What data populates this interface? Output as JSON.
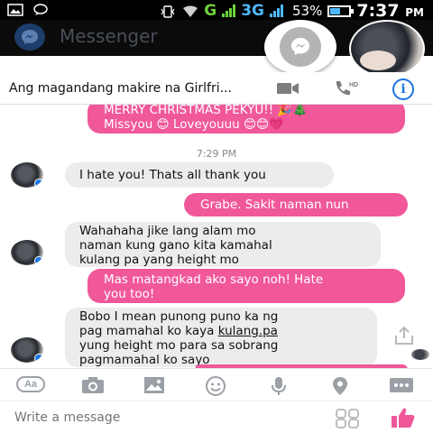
{
  "status_bar": {
    "network_g": "G",
    "network_3g": "3G",
    "battery": "53%",
    "battery_level": 0.53,
    "time": "7:37",
    "ampm": "PM"
  },
  "app_bar": {
    "title": "Messenger"
  },
  "conversation": {
    "name": "Ang magandang makire na Girlfri...",
    "icons": [
      "video-camera-icon",
      "phone-hd-icon",
      "info-icon"
    ],
    "accent_color": "#1b74e4",
    "sent_color": "#f0589a"
  },
  "messages": [
    {
      "from": "me",
      "lines": [
        "MERRY CHRISTMAS PEKYU!! 🎉🎄",
        "Missyou 😊 Loveyouuu 😊😊💗"
      ]
    },
    {
      "type": "timestamp",
      "text": "7:29 PM"
    },
    {
      "from": "them",
      "text": "I hate you! Thats all thank you"
    },
    {
      "from": "me",
      "text": "Grabe. Sakit naman nun"
    },
    {
      "from": "them",
      "lines": [
        "Wahahaha jike lang alam mo",
        "naman kung gano kita kamahal",
        "kulang pa yang height mo"
      ]
    },
    {
      "from": "me",
      "lines": [
        "Mas matangkad ako sayo noh! Hate",
        "you too!"
      ]
    },
    {
      "from": "them",
      "lines": [
        "Bobo I mean punong puno ka ng",
        "pag mamahal ko kaya ",
        "kulang.pa",
        "yung height mo para sa sobrang",
        "pagmamahal ko sayo"
      ]
    }
  ],
  "toolbar": {
    "text_icon_label": "Aa",
    "items": [
      "text-format-icon",
      "camera-icon",
      "gallery-icon",
      "emoji-icon",
      "microphone-icon",
      "location-icon",
      "more-icon"
    ]
  },
  "composer": {
    "placeholder": "Write a message"
  }
}
